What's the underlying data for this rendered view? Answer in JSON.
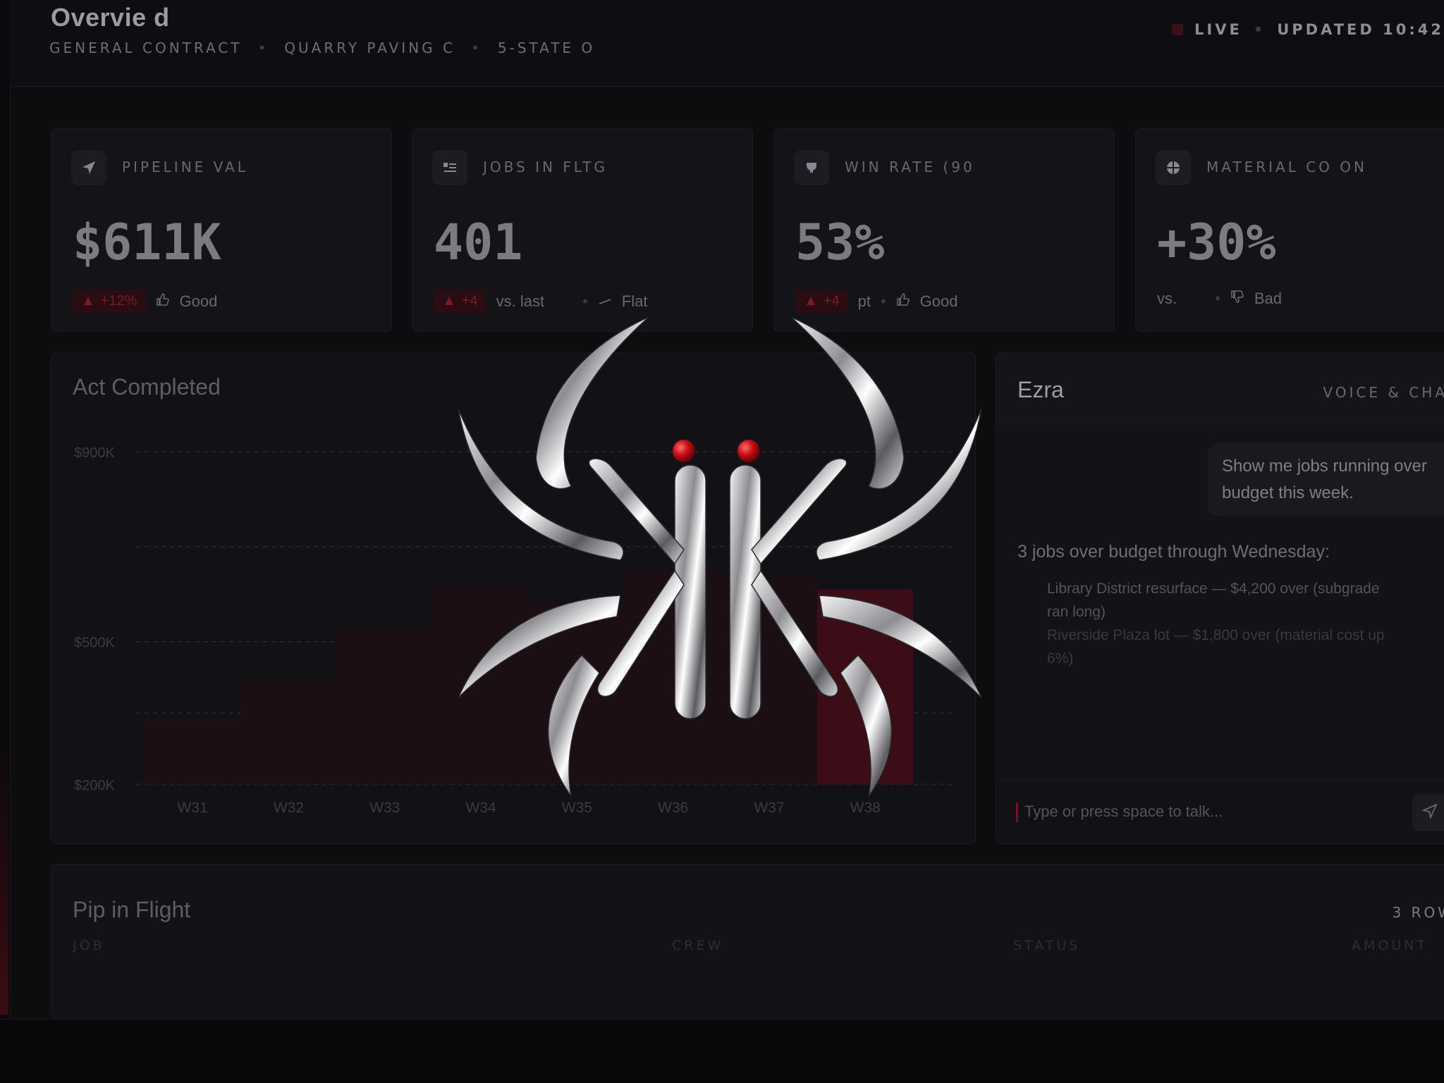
{
  "header": {
    "title": "Overvie  d",
    "subtitle": [
      "GENERAL CONTRACT",
      "QUARRY PAVING C",
      "5-STATE O"
    ],
    "live_label": "LIVE",
    "updated": "UPDATED 10:42"
  },
  "kpis": [
    {
      "icon": "send-icon",
      "label": "PIPELINE VAL",
      "value": "$611K",
      "delta": "+12%",
      "note": "",
      "rating": "Good",
      "rating_icon": "thumbs-up-icon"
    },
    {
      "icon": "list-icon",
      "label": "JOBS IN FLTG",
      "value": "401",
      "delta": "+4",
      "note": "vs. last",
      "rating": "Flat",
      "rating_icon": "flat-line-icon"
    },
    {
      "icon": "trophy-icon",
      "label": "WIN RATE (90",
      "value": "53%",
      "delta": "+4",
      "note": "pt",
      "rating": "Good",
      "rating_icon": "thumbs-up-icon"
    },
    {
      "icon": "box-icon",
      "label": "MATERIAL CO   ON",
      "value": "+30%",
      "delta": "",
      "note": "vs.",
      "rating": "Bad",
      "rating_icon": "thumbs-down-icon"
    }
  ],
  "chart_panel": {
    "title": "Act  Completed"
  },
  "chart_data": {
    "type": "area",
    "title": "Act  Completed",
    "categories": [
      "W31",
      "W32",
      "W33",
      "W34",
      "W35",
      "W36",
      "W37",
      "W38"
    ],
    "y_ticks": [
      "$900K",
      "$500K",
      "$200K"
    ],
    "ylim": [
      200,
      900
    ],
    "grid": true,
    "series": [
      {
        "values": [
          340,
          420,
          530,
          620,
          580,
          650,
          640,
          610
        ]
      }
    ],
    "highlight_category": "W38"
  },
  "assistant": {
    "name": "Ezra",
    "tag": "VOICE & CHA",
    "user_message": "Show me jobs running over budget this week.",
    "bot_intro": "3 jobs over budget through Wednesday:",
    "bot_items": [
      "Library District resurface — $4,200 over (subgrade ran long)",
      "Riverside Plaza lot — $1,800 over (material cost up 6%)"
    ],
    "input_placeholder": "Type or press space to talk..."
  },
  "pipeline": {
    "title": "Pip  in Flight",
    "row_count": "3 ROW",
    "columns": [
      "JOB",
      "CREW",
      "STATUS",
      "AMOUNT"
    ]
  },
  "colors": {
    "accent": "#7a1020",
    "background": "#0d0c0f",
    "panel": "#141317"
  },
  "logo": {
    "icon": "chrome-spider-logo-icon"
  }
}
